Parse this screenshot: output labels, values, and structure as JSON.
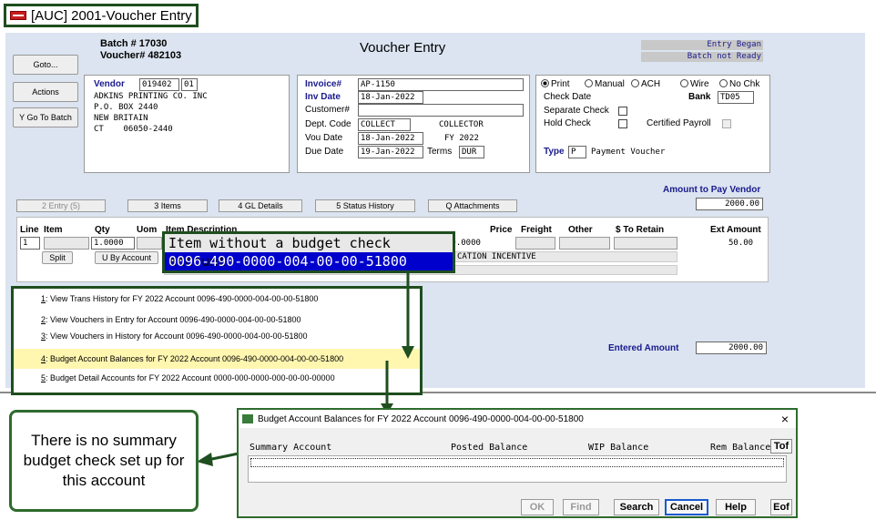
{
  "window": {
    "title": "[AUC] 2001-Voucher Entry"
  },
  "header": {
    "batch": "Batch   # 17030",
    "voucher": "Voucher# 482103",
    "form_title": "Voucher Entry",
    "entry_began": "Entry Began",
    "batch_status": "Batch not Ready"
  },
  "side_buttons": [
    "Goto...",
    "Actions",
    "Y Go To Batch"
  ],
  "vendor": {
    "label": "Vendor",
    "id": "019402",
    "suffix": "01",
    "lines": [
      "ADKINS PRINTING CO. INC",
      "P.O. BOX 2440",
      "NEW BRITAIN",
      "CT    06050-2440"
    ]
  },
  "invoice": {
    "invoice_label": "Invoice#",
    "invoice": "AP-1150",
    "inv_date_label": "Inv Date",
    "inv_date": "18-Jan-2022",
    "customer_label": "Customer#",
    "customer": "",
    "dept_label": "Dept. Code",
    "dept": "COLLECT",
    "dept_name": "COLLECTOR",
    "vou_date_label": "Vou Date",
    "vou_date": "18-Jan-2022",
    "fy": "FY 2022",
    "due_date_label": "Due Date",
    "due_date": "19-Jan-2022",
    "terms_label": "Terms",
    "terms": "DUR"
  },
  "payment": {
    "print": "Print",
    "manual": "Manual",
    "ach": "ACH",
    "wire": "Wire",
    "nochk": "No Chk",
    "check_date": "Check Date",
    "bank_label": "Bank",
    "bank": "TD05",
    "separate": "Separate Check",
    "hold": "Hold Check",
    "certified": "Certified Payroll",
    "type_label": "Type",
    "type": "P",
    "type_desc": "Payment Voucher"
  },
  "amount_to_pay": {
    "label": "Amount to Pay Vendor",
    "value": "2000.00"
  },
  "tabs": [
    "2 Entry (5)",
    "3 Items",
    "4 GL Details",
    "5 Status History",
    "Q Attachments"
  ],
  "grid": {
    "headers": [
      "Line",
      "Item",
      "Qty",
      "Uom",
      "Item Description",
      "Price",
      "Freight",
      "Other",
      "$ To Retain",
      "Ext Amount"
    ],
    "line": "1",
    "qty": "1.0000",
    "price": "50.0000",
    "ext": "50.00",
    "desc2": "CATION INCENTIVE",
    "split": "Split",
    "by_account": "U By Account"
  },
  "tooltip": {
    "text": "Item without a budget check account",
    "account": "0096-490-0000-004-00-00-51800"
  },
  "context_menu": [
    {
      "key": "1",
      "label": ": View Trans History for FY 2022 Account 0096-490-0000-004-00-00-51800"
    },
    {
      "key": "2",
      "label": ": View Vouchers in Entry for Account 0096-490-0000-004-00-00-51800"
    },
    {
      "key": "3",
      "label": ": View Vouchers in History for Account 0096-490-0000-004-00-00-51800"
    },
    {
      "key": "4",
      "label": ": Budget Account Balances for FY 2022 Account 0096-490-0000-004-00-00-51800"
    },
    {
      "key": "5",
      "label": ": Budget Detail Accounts for FY 2022 Account 0000-000-0000-000-00-00-00000"
    }
  ],
  "entered_amount": {
    "label": "Entered Amount",
    "value": "2000.00"
  },
  "dialog": {
    "title": "Budget Account Balances for FY 2022 Account 0096-490-0000-004-00-00-51800",
    "close": "×",
    "cols": [
      "Summary Account",
      "Posted Balance",
      "WIP Balance",
      "Rem Balance"
    ],
    "tof": "Tof",
    "eof": "Eof",
    "buttons": [
      "OK",
      "Find",
      "Search",
      "Cancel",
      "Help"
    ]
  },
  "callout": "There is no summary budget check set up for this account",
  "colors": {
    "accent": "#2e6b2e",
    "navy": "#1a1a8c",
    "highlight": "#0000cc",
    "menu_hl": "#fff6b0"
  }
}
